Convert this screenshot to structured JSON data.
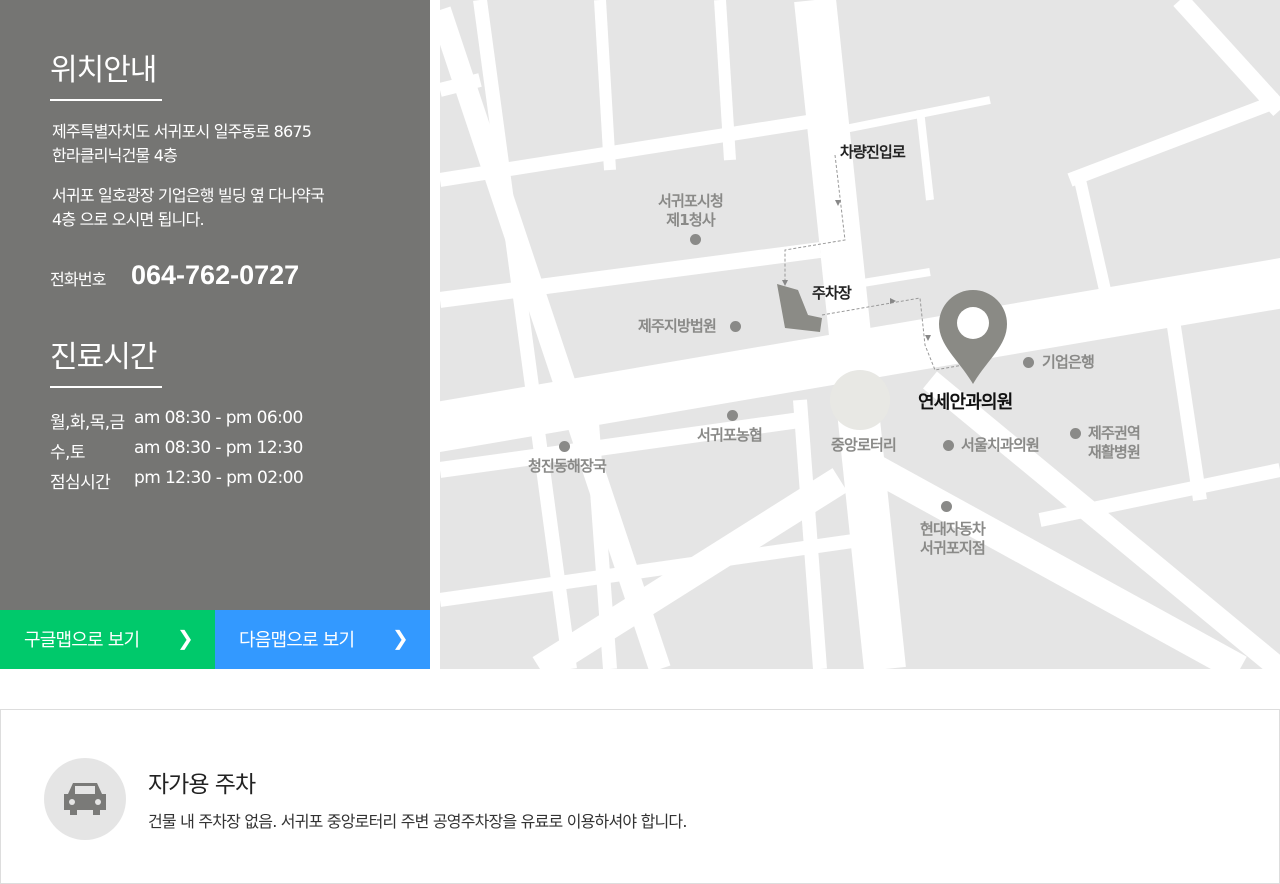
{
  "location": {
    "title": "위치안내",
    "address": [
      "제주특별자치도 서귀포시 일주동로 8675",
      "한라클리닉건물 4층"
    ],
    "directions": [
      "서귀포 일호광장 기업은행 빌딩 옆 다나약국",
      "4층 으로 오시면 됩니다."
    ],
    "phone_label": "전화번호",
    "phone": "064-762-0727"
  },
  "hours": {
    "title": "진료시간",
    "rows": [
      {
        "day": "월,화,목,금",
        "time": "am 08:30 - pm 06:00"
      },
      {
        "day": "수,토",
        "time": "am 08:30 - pm 12:30"
      },
      {
        "day": "점심시간",
        "time": "pm 12:30 - pm 02:00"
      }
    ]
  },
  "buttons": {
    "google": "구글맵으로 보기",
    "daum": "다음맵으로 보기",
    "google_color": "#00c96b",
    "daum_color": "#3399ff"
  },
  "map": {
    "labels": {
      "entry": "차량진입로",
      "parking": "주차장",
      "clinic": "연세안과의원",
      "city_hall": [
        "서귀포시청",
        "제1청사"
      ],
      "court": "제주지방법원",
      "ibk": "기업은행",
      "nonghyup": "서귀포농협",
      "rotary": "중앙로터리",
      "dental": "서울치과의원",
      "rehab": [
        "제주권역",
        "재활병원"
      ],
      "cheongjin": "청진동해장국",
      "hyundai": [
        "현대자동차",
        "서귀포지점"
      ]
    }
  },
  "parking": {
    "title": "자가용 주차",
    "desc": "건물 내 주차장 없음. 서귀포 중앙로터리 주변 공영주차장을 유료로 이용하셔야 합니다."
  }
}
